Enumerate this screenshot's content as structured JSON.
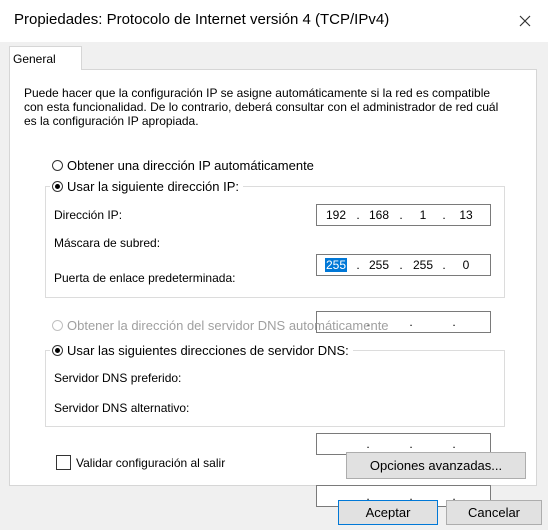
{
  "window": {
    "title": "Propiedades: Protocolo de Internet versión 4 (TCP/IPv4)",
    "close_icon": "close-icon"
  },
  "tabs": [
    {
      "label": "General",
      "active": true
    }
  ],
  "intro": "Puede hacer que la configuración IP se asigne automáticamente si la red es compatible con esta funcionalidad. De lo contrario, deberá consultar con el administrador de red cuál es la configuración IP apropiada.",
  "ip": {
    "auto_label": "Obtener una dirección IP automáticamente",
    "manual_label": "Usar la siguiente dirección IP:",
    "selected": "manual",
    "fields": [
      {
        "label": "Dirección IP:",
        "octets": [
          "192",
          "168",
          "1",
          "13"
        ]
      },
      {
        "label": "Máscara de subred:",
        "octets": [
          "255",
          "255",
          "255",
          "0"
        ],
        "selected_octet": 0
      },
      {
        "label": "Puerta de enlace predeterminada:",
        "octets": [
          "",
          "",
          "",
          ""
        ]
      }
    ]
  },
  "dns": {
    "auto_label": "Obtener la dirección del servidor DNS automáticamente",
    "auto_disabled": true,
    "manual_label": "Usar las siguientes direcciones de servidor DNS:",
    "selected": "manual",
    "fields": [
      {
        "label": "Servidor DNS preferido:",
        "octets": [
          "",
          "",
          "",
          ""
        ]
      },
      {
        "label": "Servidor DNS alternativo:",
        "octets": [
          "",
          "",
          "",
          ""
        ]
      }
    ]
  },
  "validate": {
    "label": "Validar configuración al salir",
    "checked": false
  },
  "buttons": {
    "advanced": "Opciones avanzadas...",
    "ok": "Aceptar",
    "cancel": "Cancelar"
  },
  "colors": {
    "selection": "#0078d7",
    "default_button_border": "#0078d7"
  }
}
